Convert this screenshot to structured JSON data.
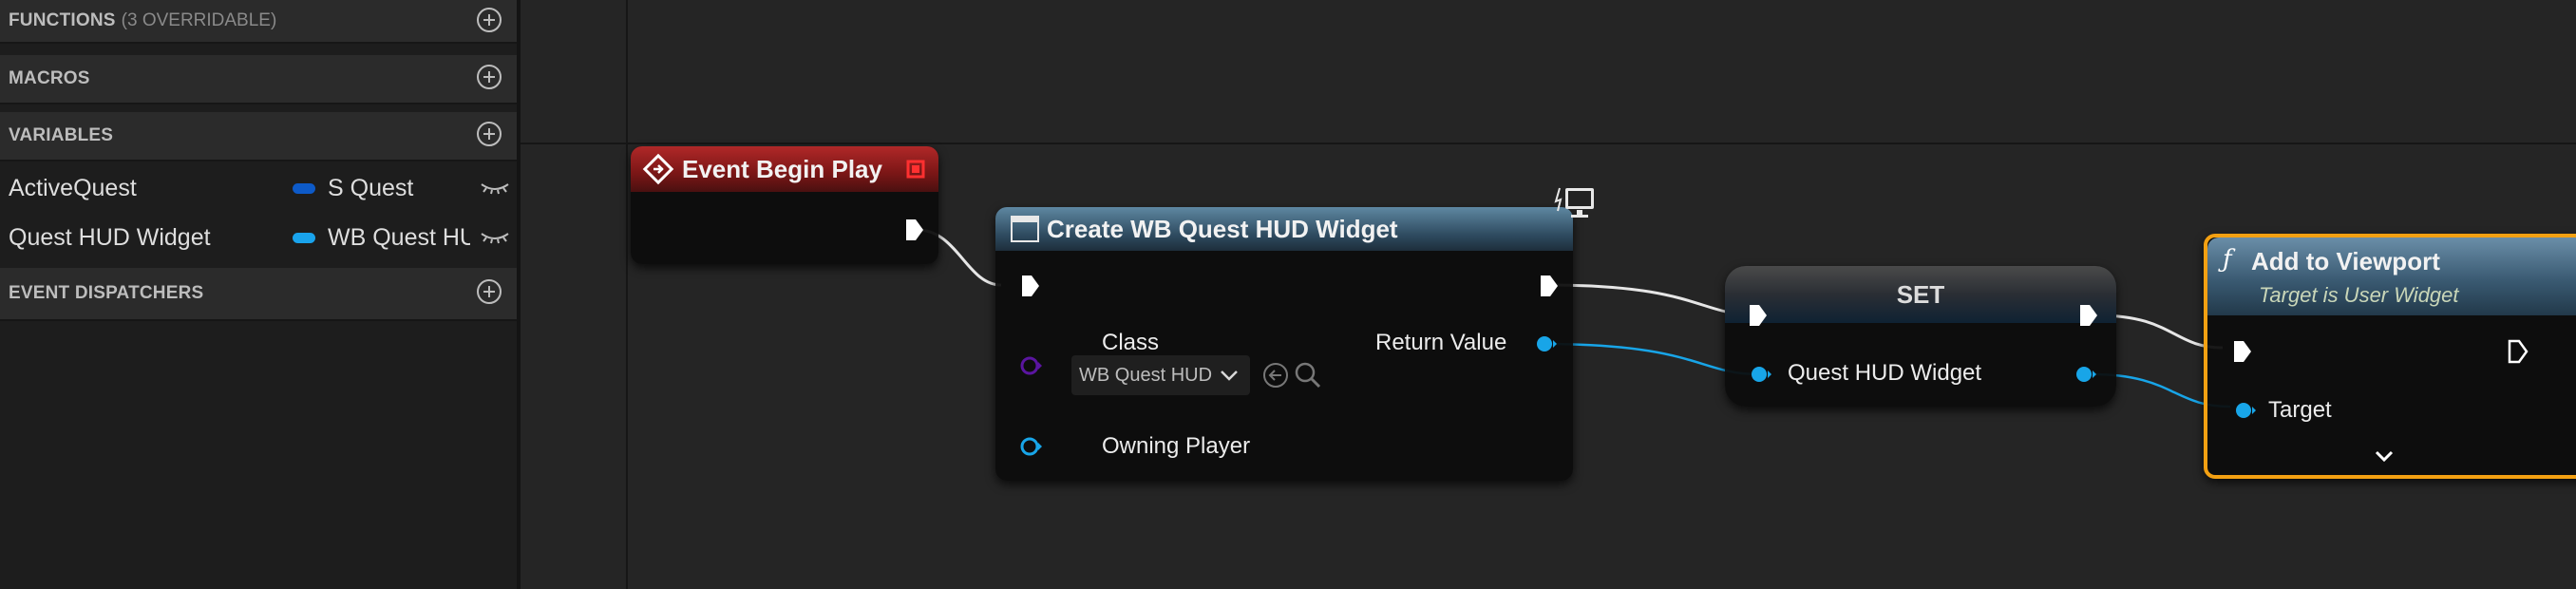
{
  "left_panel": {
    "functions": {
      "label": "FUNCTIONS",
      "sub": "(3 OVERRIDABLE)"
    },
    "macros": {
      "label": "MACROS"
    },
    "variables": {
      "label": "VARIABLES",
      "items": [
        {
          "name": "ActiveQuest",
          "type": "S Quest",
          "color": "#0d5ac8"
        },
        {
          "name": "Quest HUD Widget",
          "type": "WB Quest HU",
          "color": "#19a3ec"
        }
      ]
    },
    "event_dispatchers": {
      "label": "EVENT DISPATCHERS"
    }
  },
  "graph": {
    "event_begin_play": {
      "title": "Event Begin Play"
    },
    "create_widget": {
      "title": "Create WB Quest HUD Widget",
      "class_label": "Class",
      "class_value": "WB Quest HUD",
      "return_label": "Return Value",
      "owning_label": "Owning Player"
    },
    "set_node": {
      "title": "SET",
      "var_label": "Quest HUD Widget"
    },
    "add_viewport": {
      "title": "Add to Viewport",
      "subtitle": "Target is User Widget",
      "target_label": "Target"
    }
  },
  "colors": {
    "event_header": "#8c1d1d",
    "function_header": "#3b5f77",
    "selection_outline": "#f3a012",
    "object_pin": "#18a5e8",
    "class_pin": "#5a15a0"
  }
}
